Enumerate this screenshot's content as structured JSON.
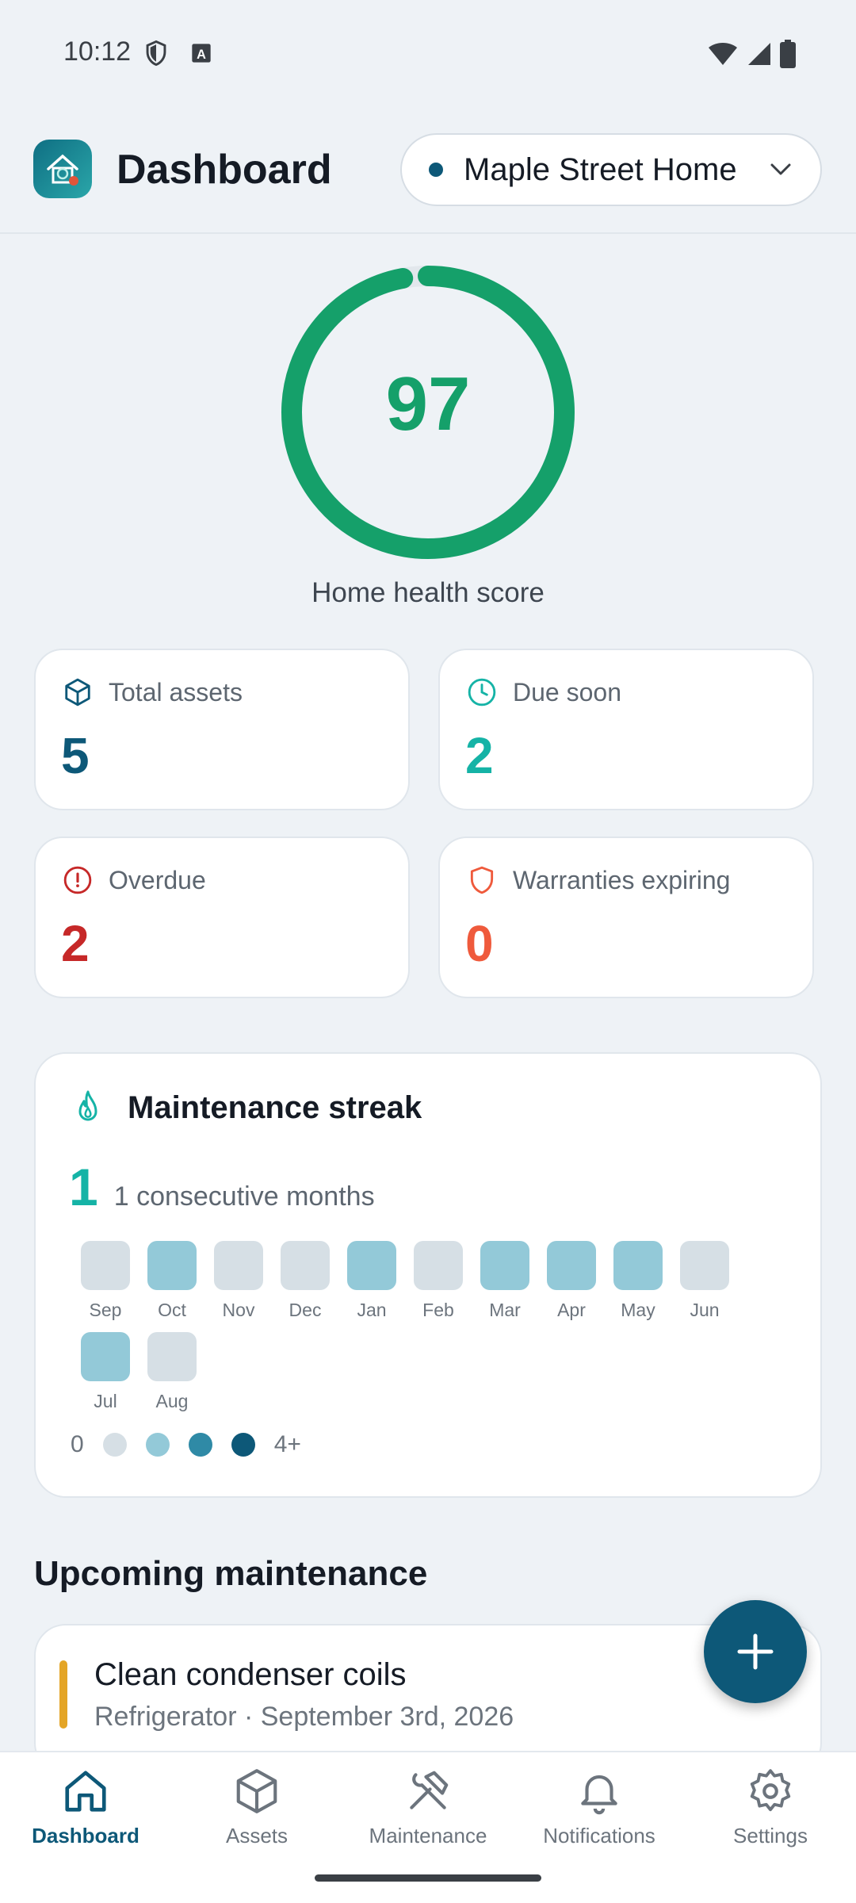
{
  "status_bar": {
    "time": "10:12"
  },
  "header": {
    "title": "Dashboard",
    "home_selector": {
      "value": "Maple Street Home",
      "dot_color": "#0d5878"
    }
  },
  "health": {
    "score": "97",
    "label": "Home health score",
    "fraction": 0.97,
    "color": "#15a06a"
  },
  "stats": [
    {
      "label": "Total assets",
      "value": "5",
      "icon": "cube-icon",
      "color": "#0d5878"
    },
    {
      "label": "Due soon",
      "value": "2",
      "icon": "clock-icon",
      "color": "#15b3a6"
    },
    {
      "label": "Overdue",
      "value": "2",
      "icon": "alert-circle-icon",
      "color": "#c62828"
    },
    {
      "label": "Warranties expiring",
      "value": "0",
      "icon": "shield-icon",
      "color": "#ef5a3c"
    }
  ],
  "streak": {
    "title": "Maintenance streak",
    "count": "1",
    "unit": "1 consecutive months",
    "months": [
      {
        "label": "Sep",
        "level": 0
      },
      {
        "label": "Oct",
        "level": 1
      },
      {
        "label": "Nov",
        "level": 0
      },
      {
        "label": "Dec",
        "level": 0
      },
      {
        "label": "Jan",
        "level": 1
      },
      {
        "label": "Feb",
        "level": 0
      },
      {
        "label": "Mar",
        "level": 1
      },
      {
        "label": "Apr",
        "level": 1
      },
      {
        "label": "May",
        "level": 1
      },
      {
        "label": "Jun",
        "level": 0
      },
      {
        "label": "Jul",
        "level": 1
      },
      {
        "label": "Aug",
        "level": 0
      }
    ],
    "legend": {
      "min": "0",
      "max": "4+",
      "colors": [
        "#d6dfe5",
        "#93c9d8",
        "#2f8aa6",
        "#0d5878"
      ]
    }
  },
  "upcoming": {
    "title": "Upcoming maintenance",
    "items": [
      {
        "title": "Clean condenser coils",
        "subtitle": "Refrigerator · September 3rd, 2026",
        "accent": "#e4a526"
      }
    ]
  },
  "nav": {
    "items": [
      {
        "label": "Dashboard",
        "icon": "home-icon",
        "active": true
      },
      {
        "label": "Assets",
        "icon": "cube-icon",
        "active": false
      },
      {
        "label": "Maintenance",
        "icon": "tools-icon",
        "active": false
      },
      {
        "label": "Notifications",
        "icon": "bell-icon",
        "active": false
      },
      {
        "label": "Settings",
        "icon": "gear-icon",
        "active": false
      }
    ]
  }
}
